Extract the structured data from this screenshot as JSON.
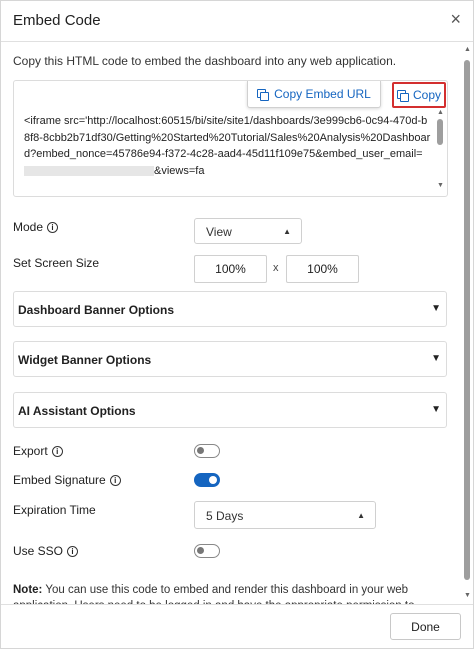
{
  "dialog": {
    "title": "Embed Code",
    "close_glyph": "×"
  },
  "description": "Copy this HTML code to embed the dashboard into any web application.",
  "code": {
    "copy_embed_url_label": "Copy Embed URL",
    "copy_label": "Copy",
    "text_part1": "<iframe src='http://localhost:60515/bi/site/site1/dashboards/3e999cb6-0c94-470d-b8f8-8cbb2b71df30/Getting%20Started%20Tutorial/Sales%20Analysis%20Dashboard?embed_nonce=45786e94-f372-4c28-aad4-45d11f109e75&embed_user_email=",
    "text_part2": "&views=fa"
  },
  "mode": {
    "label": "Mode",
    "value": "View"
  },
  "screen_size": {
    "label": "Set Screen Size",
    "width": "100%",
    "separator": "x",
    "height": "100%"
  },
  "accordions": [
    {
      "label": "Dashboard Banner Options"
    },
    {
      "label": "Widget Banner Options"
    },
    {
      "label": "AI Assistant Options"
    }
  ],
  "export": {
    "label": "Export",
    "enabled": false
  },
  "embed_signature": {
    "label": "Embed Signature",
    "enabled": true
  },
  "expiration": {
    "label": "Expiration Time",
    "value": "5 Days"
  },
  "use_sso": {
    "label": "Use SSO",
    "enabled": false
  },
  "note": {
    "prefix": "Note:",
    "text": " You can use this code to embed and render this dashboard in your web application. Users need to be logged in and have the appropriate permission to"
  },
  "footer": {
    "done_label": "Done"
  },
  "colors": {
    "accent": "#1565c0",
    "highlight_border": "#d32f2f"
  },
  "icons": {
    "close": "close-icon",
    "copy": "copy-icon",
    "info": "info-icon",
    "dropdown": "caret-down-icon"
  }
}
